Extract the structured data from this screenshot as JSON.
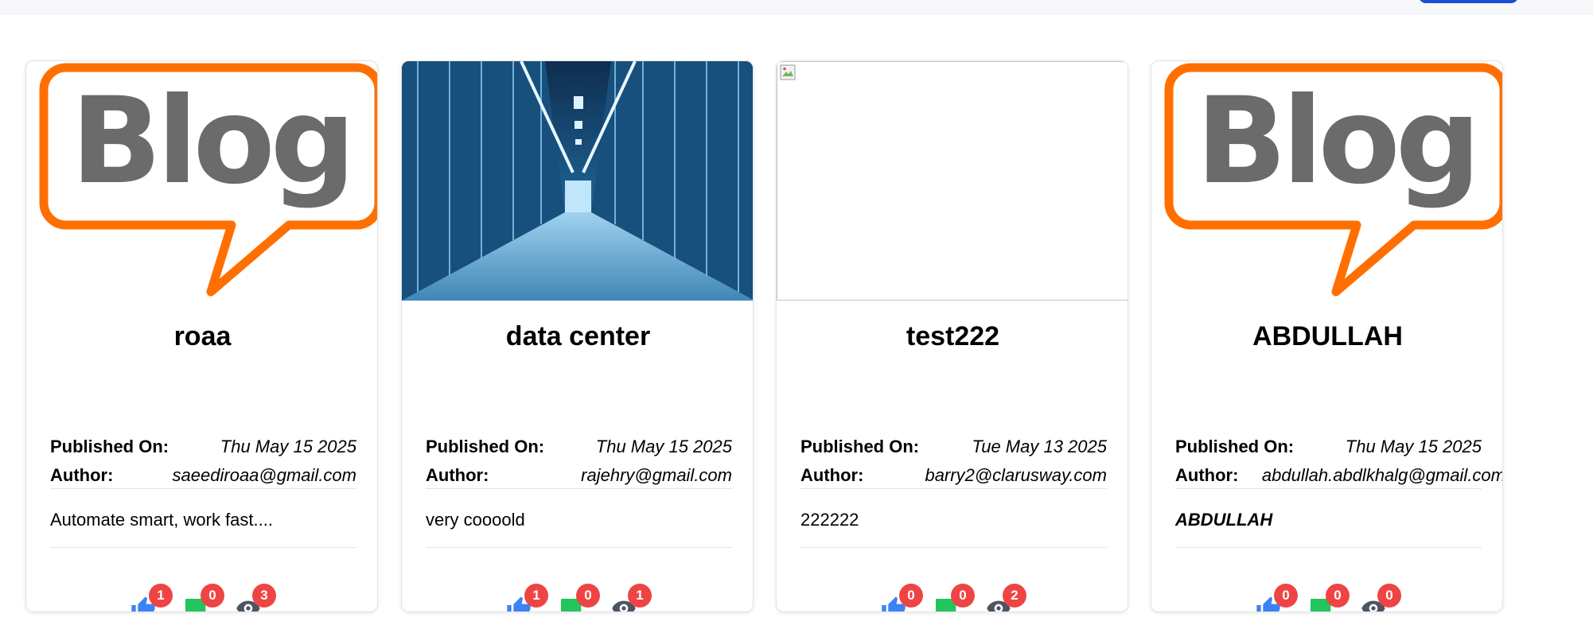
{
  "colors": {
    "like": "#3b82f6",
    "comment": "#22c55e",
    "view": "#4b5563",
    "badge": "#ef4444",
    "blog_orange": "#ff6f00",
    "blog_gray": "#6b6b6b"
  },
  "images": {
    "blog_logo_text": "Blog"
  },
  "labels": {
    "published_on": "Published On:",
    "author": "Author:"
  },
  "cards": [
    {
      "title": "roaa",
      "published": "Thu May 15 2025",
      "author": "saeediroaa@gmail.com",
      "content": "Automate smart, work fast....",
      "likes": "1",
      "comments": "0",
      "views": "3"
    },
    {
      "title": "data center",
      "published": "Thu May 15 2025",
      "author": "rajehry@gmail.com",
      "content": "very coooold",
      "likes": "1",
      "comments": "0",
      "views": "1"
    },
    {
      "title": "test222",
      "published": "Tue May 13 2025",
      "author": "barry2@clarusway.com",
      "content": "222222",
      "likes": "0",
      "comments": "0",
      "views": "2"
    },
    {
      "title": "ABDULLAH",
      "published": "Thu May 15 2025",
      "author": "abdullah.abdlkhalg@gmail.com",
      "content": "ABDULLAH",
      "likes": "0",
      "comments": "0",
      "views": "0"
    }
  ]
}
